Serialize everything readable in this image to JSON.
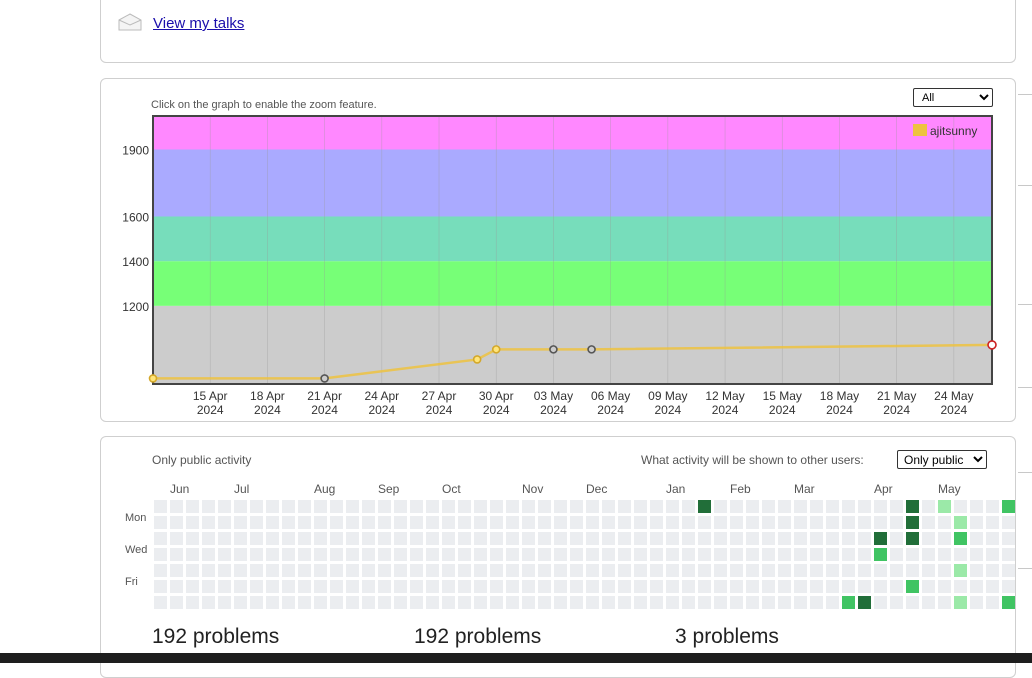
{
  "talks": {
    "link_label": "View my talks"
  },
  "graph": {
    "hint": "Click on the graph to enable the zoom feature.",
    "filter_value": "All",
    "legend_name": "ajitsunny"
  },
  "chart_data": {
    "type": "line",
    "title": "",
    "series": [
      {
        "name": "ajitsunny",
        "color": "#e8b84b",
        "points": [
          [
            "2024-04-12",
            875
          ],
          [
            "2024-04-21",
            875
          ],
          [
            "2024-04-29",
            960
          ],
          [
            "2024-04-30",
            1005
          ],
          [
            "2024-05-03",
            1005
          ],
          [
            "2024-05-05",
            1005
          ],
          [
            "2024-05-26",
            1025
          ]
        ]
      }
    ],
    "y_ticks": [
      1200,
      1400,
      1600,
      1900
    ],
    "ylim": [
      850,
      2050
    ],
    "x_ticks": [
      "15 Apr 2024",
      "18 Apr 2024",
      "21 Apr 2024",
      "24 Apr 2024",
      "27 Apr 2024",
      "30 Apr 2024",
      "03 May 2024",
      "06 May 2024",
      "09 May 2024",
      "12 May 2024",
      "15 May 2024",
      "18 May 2024",
      "21 May 2024",
      "24 May 2024"
    ],
    "bands": [
      {
        "from": 850,
        "to": 1200,
        "color": "#cccccc"
      },
      {
        "from": 1200,
        "to": 1400,
        "color": "#77ff77"
      },
      {
        "from": 1400,
        "to": 1600,
        "color": "#77ddbb"
      },
      {
        "from": 1600,
        "to": 1900,
        "color": "#aaaaff"
      },
      {
        "from": 1900,
        "to": 2050,
        "color": "#ff88ff"
      }
    ],
    "grid": true,
    "legend_position": "top-right"
  },
  "activity": {
    "scope_label": "Only public activity",
    "visibility_label": "What activity will be shown to other users:",
    "visibility_value": "Only public",
    "months": [
      "Jun",
      "Jul",
      "Aug",
      "Sep",
      "Oct",
      "Nov",
      "Dec",
      "Jan",
      "Feb",
      "Mar",
      "Apr",
      "May"
    ],
    "days": [
      "Mon",
      "Wed",
      "Fri"
    ],
    "active_days": [
      {
        "week": 34,
        "day": 0,
        "level": 3
      },
      {
        "week": 43,
        "day": 6,
        "level": 2
      },
      {
        "week": 44,
        "day": 6,
        "level": 3
      },
      {
        "week": 45,
        "day": 2,
        "level": 3
      },
      {
        "week": 45,
        "day": 3,
        "level": 2
      },
      {
        "week": 47,
        "day": 0,
        "level": 3
      },
      {
        "week": 47,
        "day": 1,
        "level": 3
      },
      {
        "week": 47,
        "day": 2,
        "level": 3
      },
      {
        "week": 47,
        "day": 5,
        "level": 2
      },
      {
        "week": 49,
        "day": 0,
        "level": 1
      },
      {
        "week": 50,
        "day": 1,
        "level": 1
      },
      {
        "week": 50,
        "day": 2,
        "level": 2
      },
      {
        "week": 50,
        "day": 4,
        "level": 1
      },
      {
        "week": 50,
        "day": 6,
        "level": 1
      },
      {
        "week": 53,
        "day": 0,
        "level": 2
      },
      {
        "week": 53,
        "day": 6,
        "level": 2
      }
    ],
    "level_colors": [
      "#ebedf0",
      "#9be9a8",
      "#40c463",
      "#216e39"
    ]
  },
  "stats": {
    "all_time": "192 problems",
    "last_year": "192 problems",
    "last_month": "3 problems"
  }
}
